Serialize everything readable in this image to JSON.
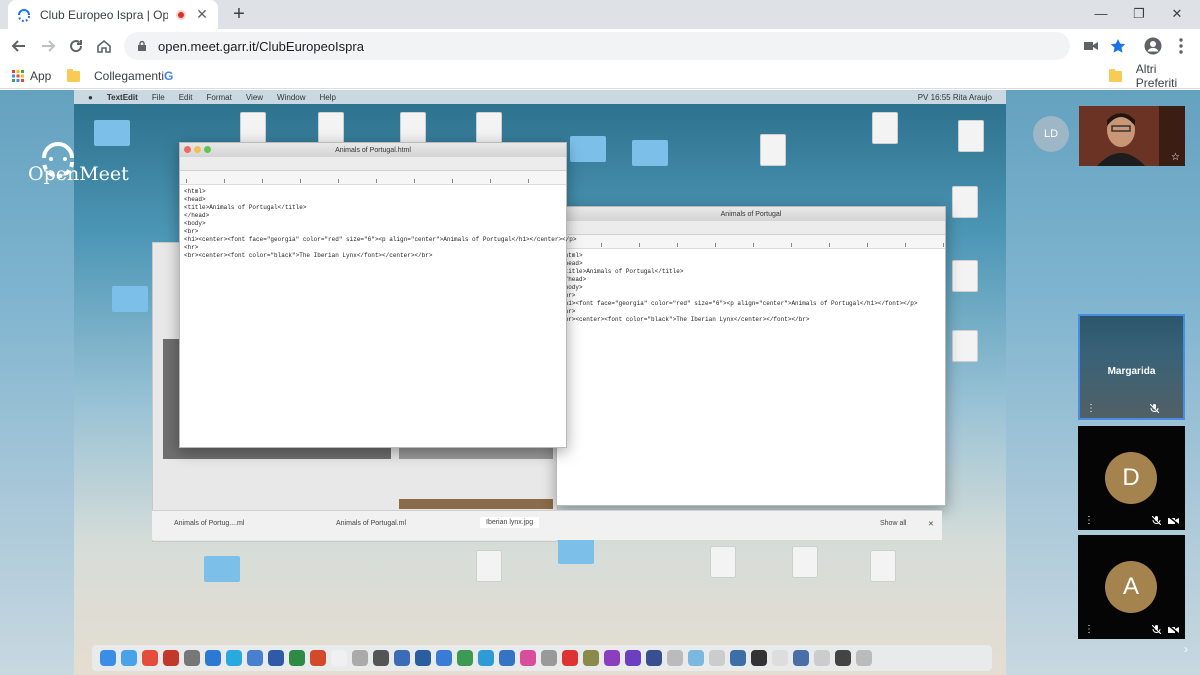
{
  "browser": {
    "tab_title": "Club Europeo Ispra | OpenM",
    "new_tab_symbol": "+",
    "close_symbol": "✕",
    "url": "open.meet.garr.it/ClubEuropeoIspra",
    "window_controls": {
      "minimize": "—",
      "maximize": "❐",
      "close": "✕"
    }
  },
  "bookmarks": [
    {
      "label": "App",
      "icon": "apps-grid-icon"
    },
    {
      "label": "Collegamenti",
      "icon": "folder-icon"
    },
    {
      "label": "",
      "icon": "google-icon"
    },
    {
      "label": "Altri Preferiti",
      "icon": "folder-icon"
    }
  ],
  "meeting": {
    "logo_text": "OpenMeet",
    "local_initials": "LD",
    "participants": [
      {
        "name": "Margarida",
        "initial": "",
        "active": true
      },
      {
        "name": "",
        "initial": "D",
        "active": false
      },
      {
        "name": "",
        "initial": "A",
        "active": false
      }
    ]
  },
  "shared_screen": {
    "menu_items": [
      "TextEdit",
      "File",
      "Edit",
      "Format",
      "View",
      "Window",
      "Help"
    ],
    "status": "PV 16:55  Rita Araujo",
    "window1_title": "Animals of Portugal.html",
    "window2_title": "Animals of Portugal",
    "window1_code": "<html>\n<head>\n<title>Animals of Portugal</title>\n</head>\n<body>\n<br>\n<h1><center><font face=\"georgia\" color=\"red\" size=\"6\"><p align=\"center\">Animals of Portugal</h1></center></p>\n<hr>\n<br><center><font color=\"black\">The Iberian Lynx</font></center></br>",
    "window2_code": "<html>\n<head>\n<title>Animals of Portugal</title>\n</head>\n<body>\n<br>\n<h1><font face=\"georgia\" color=\"red\" size=\"6\"><p align=\"center\">Animals of Portugal</h1></font></p>\n<hr>\n<br><center><font color=\"black\">The Iberian Lynx</center></font></br>",
    "downloads": [
      "Animals of Portug....ml",
      "Animals of Portugal.ml",
      "Iberian lynx.jpg"
    ],
    "show_all": "Show all"
  }
}
